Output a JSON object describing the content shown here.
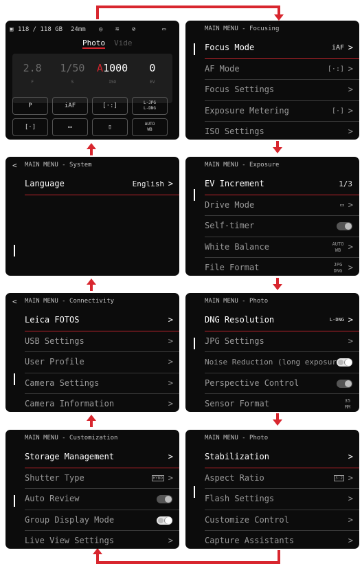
{
  "colors": {
    "accent": "#d8262e",
    "screen_bg": "#0c0c0c",
    "text": "#e8e8e8",
    "dim_text": "#9a9a9a"
  },
  "home": {
    "storage": "118 / 118 GB",
    "focal": "24mm",
    "modes": {
      "photo": "Photo",
      "video": "Vide"
    },
    "exposure": [
      {
        "value": "2.8",
        "unit": "F"
      },
      {
        "value": "1/50",
        "unit": "S"
      },
      {
        "value": "1000",
        "prefix": "A",
        "unit": "ISO"
      },
      {
        "value": "0",
        "unit": "EV"
      }
    ],
    "quick": [
      {
        "label": "P",
        "icon": "program-mode-icon"
      },
      {
        "label": "iAF",
        "icon": ""
      },
      {
        "label": "[·:]",
        "icon": "af-field-icon"
      },
      {
        "label": "L-JPG\nL-DNG",
        "icon": ""
      },
      {
        "label": "[·]",
        "icon": "metering-icon"
      },
      {
        "label": "▭",
        "icon": "single-shot-icon"
      },
      {
        "label": "▯",
        "icon": "stabilization-icon"
      },
      {
        "label": "AUTO\nWB",
        "icon": ""
      }
    ]
  },
  "focusing": {
    "header": "MAIN MENU - Focusing",
    "items": [
      {
        "label": "Focus Mode",
        "value": "iAF"
      },
      {
        "label": "AF Mode",
        "value": "[·:]"
      },
      {
        "label": "Focus Settings",
        "value": ""
      },
      {
        "label": "Exposure Metering",
        "value": "[·]"
      },
      {
        "label": "ISO Settings",
        "value": ""
      }
    ]
  },
  "system": {
    "header": "MAIN MENU - System",
    "items": [
      {
        "label": "Language",
        "value": "English"
      }
    ]
  },
  "exposure": {
    "header": "MAIN MENU - Exposure",
    "items": [
      {
        "label": "EV Increment",
        "value": "1/3"
      },
      {
        "label": "Drive Mode",
        "value": "▭"
      },
      {
        "label": "Self-timer",
        "value": ""
      },
      {
        "label": "White Balance",
        "value": "AUTO WB"
      },
      {
        "label": "File Format",
        "value": "JPG DNG"
      }
    ]
  },
  "connectivity": {
    "header": "MAIN MENU - Connectivity",
    "items": [
      {
        "label": "Leica FOTOS"
      },
      {
        "label": "USB Settings"
      },
      {
        "label": "User Profile"
      },
      {
        "label": "Camera Settings"
      },
      {
        "label": "Camera Information"
      }
    ]
  },
  "photo1": {
    "header": "MAIN MENU - Photo",
    "items": [
      {
        "label": "DNG Resolution",
        "value": "L-DNG"
      },
      {
        "label": "JPG Settings",
        "value": ""
      },
      {
        "label": "Noise Reduction (long exposure)",
        "value": ""
      },
      {
        "label": "Perspective Control",
        "value": ""
      },
      {
        "label": "Sensor Format",
        "value": "35 MM"
      }
    ]
  },
  "customization": {
    "header": "MAIN MENU - Customization",
    "items": [
      {
        "label": "Storage Management",
        "value": ""
      },
      {
        "label": "Shutter Type",
        "value": "HYBD"
      },
      {
        "label": "Auto Review",
        "value": ""
      },
      {
        "label": "Group Display Mode",
        "value": ""
      },
      {
        "label": "Live View Settings",
        "value": ""
      }
    ]
  },
  "photo2": {
    "header": "MAIN MENU - Photo",
    "items": [
      {
        "label": "Stabilization",
        "value": ""
      },
      {
        "label": "Aspect Ratio",
        "value": "3:2"
      },
      {
        "label": "Flash Settings",
        "value": ""
      },
      {
        "label": "Customize Control",
        "value": ""
      },
      {
        "label": "Capture Assistants",
        "value": ""
      }
    ]
  }
}
